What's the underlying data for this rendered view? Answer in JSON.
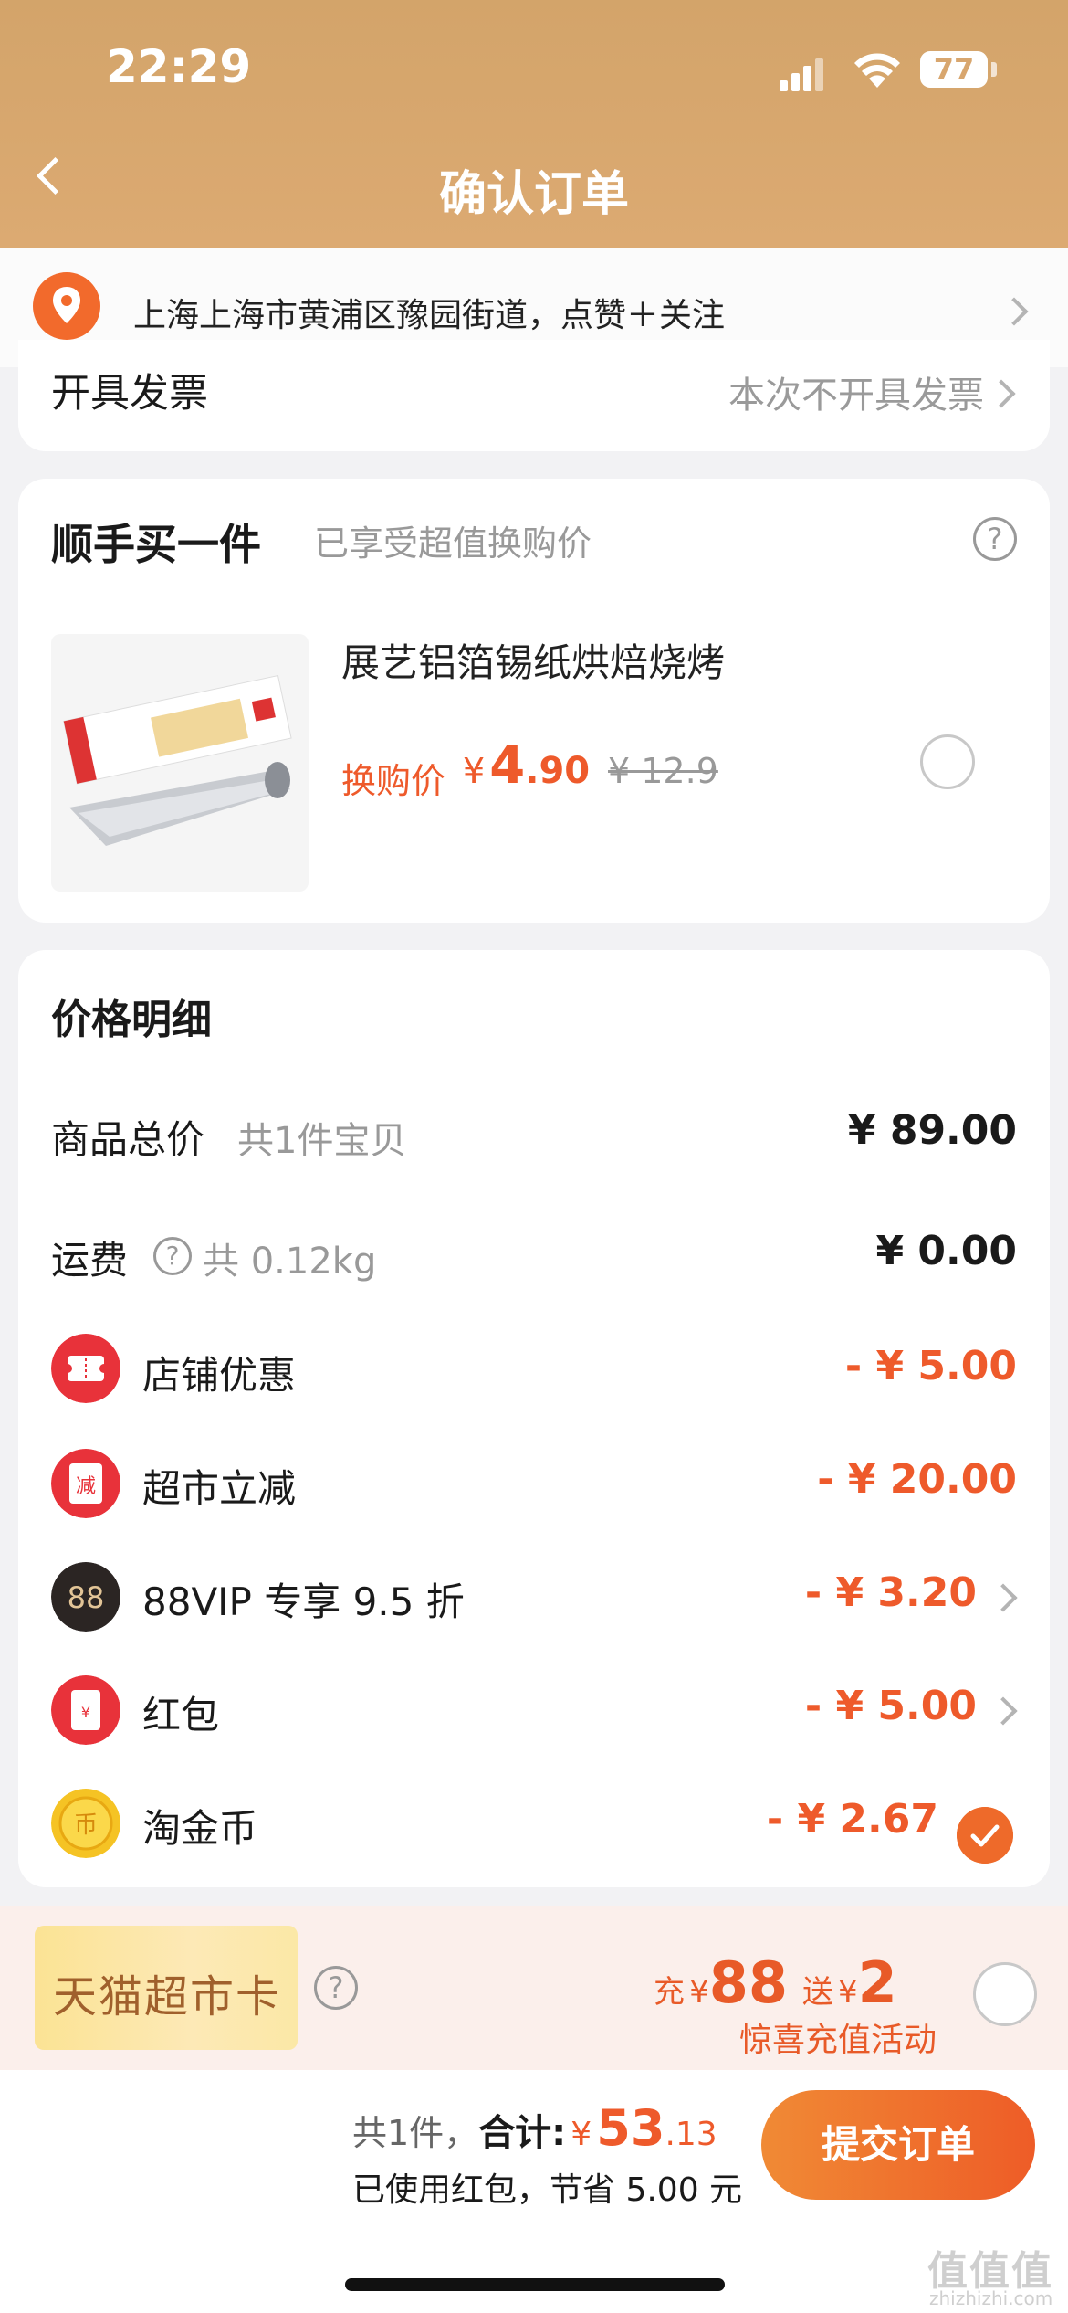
{
  "status_bar": {
    "time": "22:29",
    "battery": "77"
  },
  "nav": {
    "title": "确认订单"
  },
  "address": {
    "text": "上海上海市黄浦区豫园街道，点赞＋关注"
  },
  "invoice": {
    "label": "开具发票",
    "value": "本次不开具发票"
  },
  "swap": {
    "title": "顺手买一件",
    "subtitle": "已享受超值换购价",
    "product_name": "展艺铝箔锡纸烘焙烧烤",
    "price_label": "换购价",
    "currency": "¥",
    "price_int": "4",
    "price_dec": ".90",
    "original_price": "¥ 12.9"
  },
  "price_detail": {
    "title": "价格明细",
    "goods_label": "商品总价",
    "goods_sub": "共1件宝贝",
    "goods_value": "¥ 89.00",
    "shipping_label": "运费",
    "shipping_sub": "共 0.12kg",
    "shipping_value": "¥ 0.00",
    "discounts": [
      {
        "label": "店铺优惠",
        "value": "- ¥ 5.00",
        "icon": "coupon-icon"
      },
      {
        "label": "超市立减",
        "value": "- ¥ 20.00",
        "icon": "reduce-icon",
        "icon_text": "减"
      },
      {
        "label": "88VIP 专享 9.5 折",
        "value": "- ¥ 3.20",
        "icon": "vip88-icon",
        "icon_text": "88"
      },
      {
        "label": "红包",
        "value": "- ¥ 5.00",
        "icon": "red-packet-icon",
        "icon_text": "¥"
      },
      {
        "label": "淘金币",
        "value": "- ¥ 2.67",
        "icon": "gold-coin-icon",
        "icon_text": "币"
      }
    ]
  },
  "promo": {
    "card_name": "天猫超市卡",
    "charge_prefix": "充",
    "charge_currency": "¥",
    "charge_amount": "88",
    "gift_prefix": "送",
    "gift_currency": "¥",
    "gift_amount": "2",
    "subtitle": "惊喜充值活动"
  },
  "footer": {
    "count": "共1件，",
    "total_label": "合计:",
    "currency": "¥",
    "total_int": "53",
    "total_dec": ".13",
    "saving": "已使用红包，节省 5.00 元",
    "submit": "提交订单"
  },
  "watermark": {
    "main": "值值值",
    "sub": "zhizhizhi.com"
  },
  "colors": {
    "accent": "#ee5a2b",
    "header": "#d8a66e"
  }
}
